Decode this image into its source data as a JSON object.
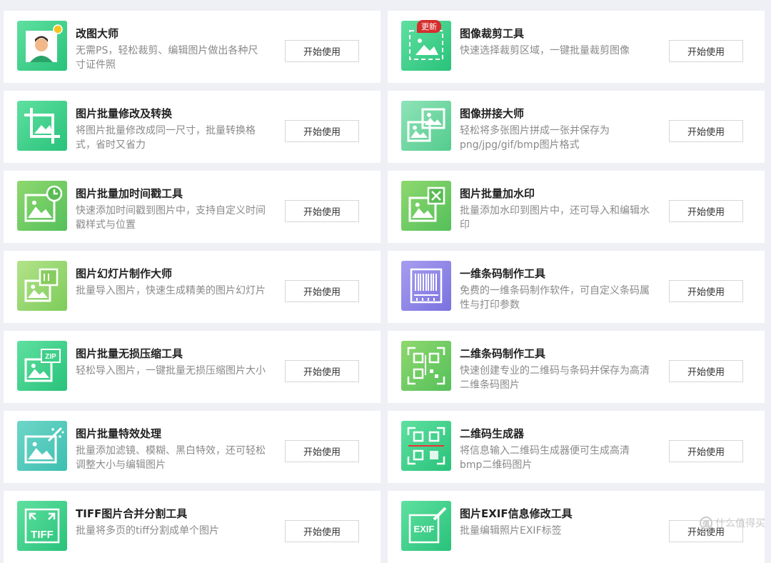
{
  "button_label": "开始使用",
  "tools": [
    {
      "title": "改图大师",
      "desc": "无需PS，轻松裁剪、编辑图片做出各种尺寸证件照",
      "icon": "portrait-icon",
      "badge": ""
    },
    {
      "title": "图像裁剪工具",
      "desc": "快速选择裁剪区域，一键批量裁剪图像",
      "icon": "crop-area-icon",
      "badge": "更新"
    },
    {
      "title": "图片批量修改及转换",
      "desc": "将图片批量修改成同一尺寸，批量转换格式，省时又省力",
      "icon": "crop-icon",
      "badge": ""
    },
    {
      "title": "图像拼接大师",
      "desc": "轻松将多张图片拼成一张并保存为png/jpg/gif/bmp图片格式",
      "icon": "image-stitch-icon",
      "badge": ""
    },
    {
      "title": "图片批量加时间戳工具",
      "desc": "快速添加时间戳到图片中，支持自定义时间戳样式与位置",
      "icon": "timestamp-icon",
      "badge": ""
    },
    {
      "title": "图片批量加水印",
      "desc": "批量添加水印到图片中，还可导入和编辑水印",
      "icon": "watermark-icon",
      "badge": ""
    },
    {
      "title": "图片幻灯片制作大师",
      "desc": "批量导入图片，快速生成精美的图片幻灯片",
      "icon": "slideshow-icon",
      "badge": ""
    },
    {
      "title": "一维条码制作工具",
      "desc": "免费的一维条码制作软件，可自定义条码属性与打印参数",
      "icon": "barcode-icon",
      "badge": ""
    },
    {
      "title": "图片批量无损压缩工具",
      "desc": "轻松导入图片，一键批量无损压缩图片大小",
      "icon": "zip-icon",
      "badge": ""
    },
    {
      "title": "二维条码制作工具",
      "desc": "快速创建专业的二维码与条码并保存为高清二维条码图片",
      "icon": "qr-barcode-icon",
      "badge": ""
    },
    {
      "title": "图片批量特效处理",
      "desc": "批量添加滤镜、模糊、黑白特效，还可轻松调整大小与编辑图片",
      "icon": "magic-wand-icon",
      "badge": ""
    },
    {
      "title": "二维码生成器",
      "desc": "将信息输入二维码生成器便可生成高清bmp二维码图片",
      "icon": "qr-scan-icon",
      "badge": ""
    },
    {
      "title": "TIFF图片合并分割工具",
      "desc": "批量将多页的tiff分割成单个图片",
      "icon": "tiff-icon",
      "badge": ""
    },
    {
      "title": "图片EXIF信息修改工具",
      "desc": "批量编辑照片EXIF标签",
      "icon": "exif-icon",
      "badge": ""
    }
  ],
  "colors": {
    "green_light": "#5fe0a0",
    "green_dark": "#29c27a",
    "lime_light": "#8ed86e",
    "lime_dark": "#55c05a",
    "purple_light": "#a79df0",
    "purple_dark": "#7a72de",
    "teal_light": "#6fd6c8",
    "teal_dark": "#3cbfb0",
    "badge_red": "#d62d2d"
  },
  "watermark": {
    "text": "值 什么值得买",
    "logo": "值"
  }
}
